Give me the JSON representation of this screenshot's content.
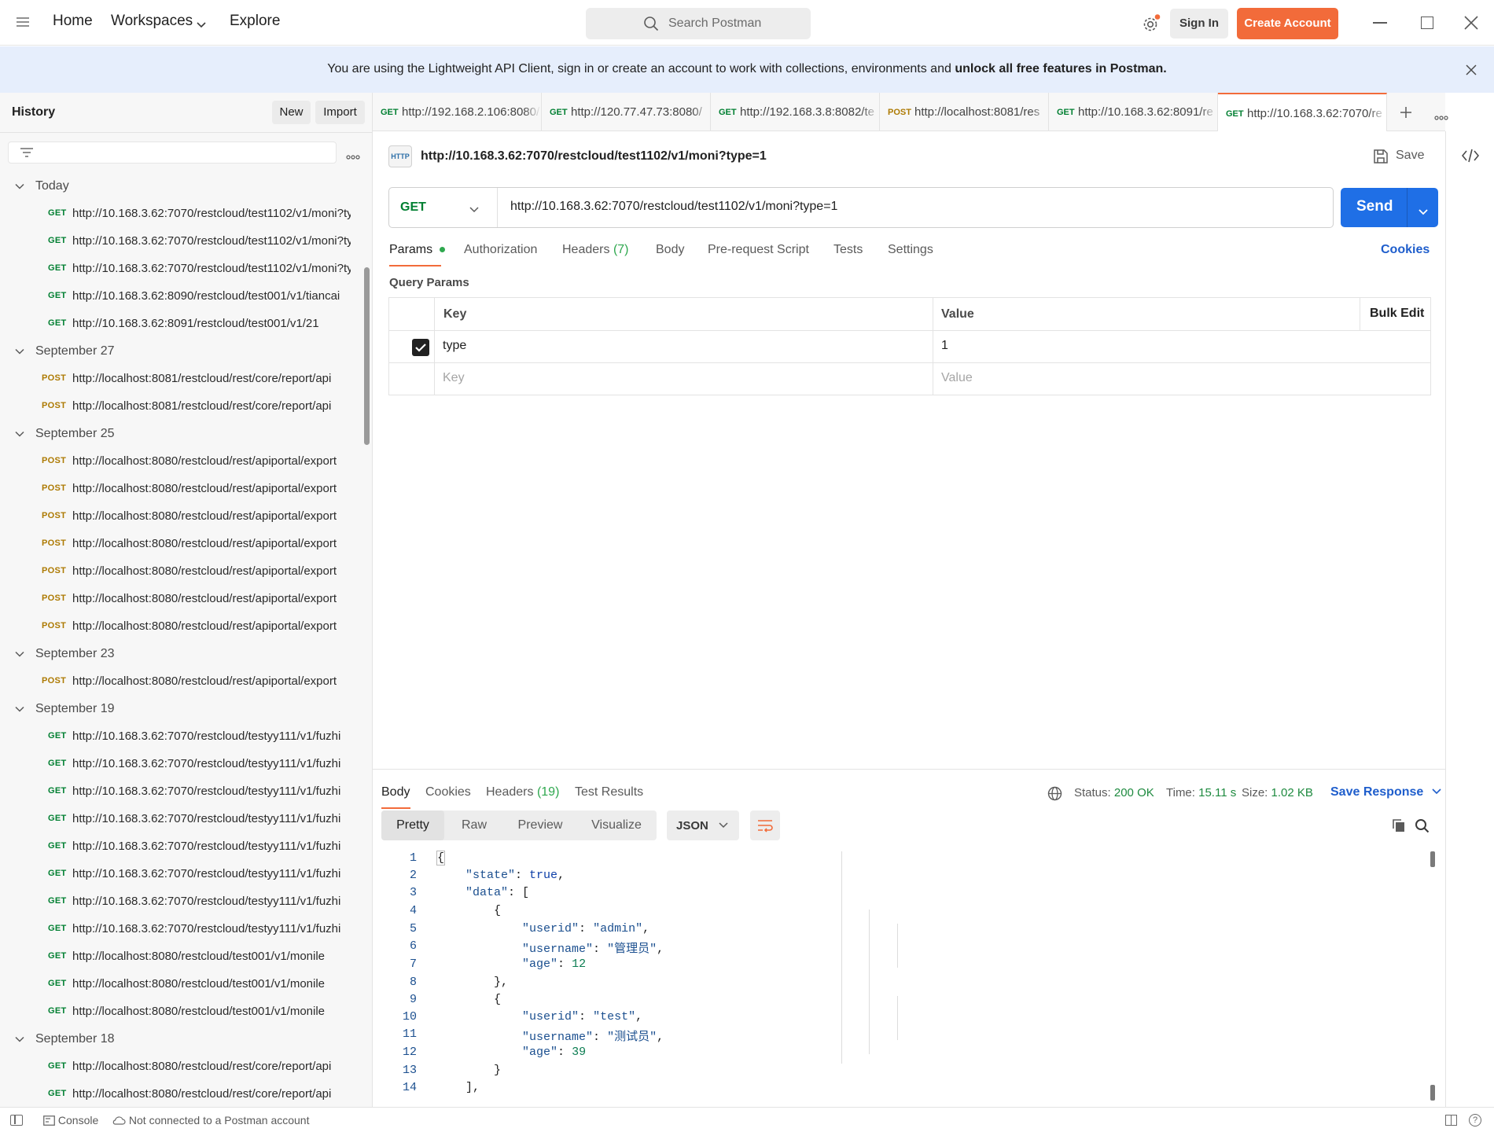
{
  "topbar": {
    "nav": {
      "home": "Home",
      "workspaces": "Workspaces",
      "explore": "Explore"
    },
    "search_label": "Search Postman",
    "sign_in": "Sign In",
    "create_account": "Create Account"
  },
  "banner": {
    "text_pre": "You are using the Lightweight API Client, sign in or create an account to work with collections, environments and ",
    "text_bold": "unlock all free features in Postman."
  },
  "sidebar": {
    "title": "History",
    "new_label": "New",
    "import_label": "Import",
    "groups": [
      {
        "label": "Today",
        "items": [
          {
            "method": "GET",
            "url": "http://10.168.3.62:7070/restcloud/test1102/v1/moni?type=1"
          },
          {
            "method": "GET",
            "url": "http://10.168.3.62:7070/restcloud/test1102/v1/moni?type=1"
          },
          {
            "method": "GET",
            "url": "http://10.168.3.62:7070/restcloud/test1102/v1/moni?type=1"
          },
          {
            "method": "GET",
            "url": "http://10.168.3.62:8090/restcloud/test001/v1/tiancai"
          },
          {
            "method": "GET",
            "url": "http://10.168.3.62:8091/restcloud/test001/v1/21"
          }
        ]
      },
      {
        "label": "September 27",
        "items": [
          {
            "method": "POST",
            "url": "http://localhost:8081/restcloud/rest/core/report/api"
          },
          {
            "method": "POST",
            "url": "http://localhost:8081/restcloud/rest/core/report/api"
          }
        ]
      },
      {
        "label": "September 25",
        "items": [
          {
            "method": "POST",
            "url": "http://localhost:8080/restcloud/rest/apiportal/export"
          },
          {
            "method": "POST",
            "url": "http://localhost:8080/restcloud/rest/apiportal/export"
          },
          {
            "method": "POST",
            "url": "http://localhost:8080/restcloud/rest/apiportal/export"
          },
          {
            "method": "POST",
            "url": "http://localhost:8080/restcloud/rest/apiportal/export"
          },
          {
            "method": "POST",
            "url": "http://localhost:8080/restcloud/rest/apiportal/export"
          },
          {
            "method": "POST",
            "url": "http://localhost:8080/restcloud/rest/apiportal/export"
          },
          {
            "method": "POST",
            "url": "http://localhost:8080/restcloud/rest/apiportal/export"
          }
        ]
      },
      {
        "label": "September 23",
        "items": [
          {
            "method": "POST",
            "url": "http://localhost:8080/restcloud/rest/apiportal/export"
          }
        ]
      },
      {
        "label": "September 19",
        "items": [
          {
            "method": "GET",
            "url": "http://10.168.3.62:7070/restcloud/testyy111/v1/fuzhi"
          },
          {
            "method": "GET",
            "url": "http://10.168.3.62:7070/restcloud/testyy111/v1/fuzhi"
          },
          {
            "method": "GET",
            "url": "http://10.168.3.62:7070/restcloud/testyy111/v1/fuzhi"
          },
          {
            "method": "GET",
            "url": "http://10.168.3.62:7070/restcloud/testyy111/v1/fuzhi"
          },
          {
            "method": "GET",
            "url": "http://10.168.3.62:7070/restcloud/testyy111/v1/fuzhi"
          },
          {
            "method": "GET",
            "url": "http://10.168.3.62:7070/restcloud/testyy111/v1/fuzhi"
          },
          {
            "method": "GET",
            "url": "http://10.168.3.62:7070/restcloud/testyy111/v1/fuzhi"
          },
          {
            "method": "GET",
            "url": "http://10.168.3.62:7070/restcloud/testyy111/v1/fuzhi"
          },
          {
            "method": "GET",
            "url": "http://localhost:8080/restcloud/test001/v1/monile"
          },
          {
            "method": "GET",
            "url": "http://localhost:8080/restcloud/test001/v1/monile"
          },
          {
            "method": "GET",
            "url": "http://localhost:8080/restcloud/test001/v1/monile"
          }
        ]
      },
      {
        "label": "September 18",
        "items": [
          {
            "method": "GET",
            "url": "http://localhost:8080/restcloud/rest/core/report/api"
          },
          {
            "method": "GET",
            "url": "http://localhost:8080/restcloud/rest/core/report/api"
          }
        ]
      }
    ]
  },
  "tabs": [
    {
      "method": "GET",
      "url": "http://192.168.2.106:8080/"
    },
    {
      "method": "GET",
      "url": "http://120.77.47.73:8080/"
    },
    {
      "method": "GET",
      "url": "http://192.168.3.8:8082/te"
    },
    {
      "method": "POST",
      "url": "http://localhost:8081/res"
    },
    {
      "method": "GET",
      "url": "http://10.168.3.62:8091/re"
    },
    {
      "method": "GET",
      "url": "http://10.168.3.62:7070/re",
      "active": true
    }
  ],
  "request": {
    "http_badge": "HTTP",
    "title": "http://10.168.3.62:7070/restcloud/test1102/v1/moni?type=1",
    "save_label": "Save",
    "method": "GET",
    "url": "http://10.168.3.62:7070/restcloud/test1102/v1/moni?type=1",
    "send_label": "Send",
    "tabs": {
      "params": "Params",
      "authorization": "Authorization",
      "headers": "Headers",
      "headers_count": "(7)",
      "body": "Body",
      "prerequest": "Pre-request Script",
      "tests": "Tests",
      "settings": "Settings"
    },
    "cookies_label": "Cookies",
    "query_params_label": "Query Params",
    "table": {
      "key_header": "Key",
      "value_header": "Value",
      "bulk_edit": "Bulk Edit",
      "rows": [
        {
          "key": "type",
          "value": "1",
          "checked": true
        }
      ],
      "key_placeholder": "Key",
      "value_placeholder": "Value"
    }
  },
  "response": {
    "tabs": {
      "body": "Body",
      "cookies": "Cookies",
      "headers": "Headers",
      "headers_count": "(19)",
      "test_results": "Test Results"
    },
    "status_label": "Status:",
    "status_value": "200 OK",
    "time_label": "Time:",
    "time_value": "15.11 s",
    "size_label": "Size:",
    "size_value": "1.02 KB",
    "save_response": "Save Response",
    "views": {
      "pretty": "Pretty",
      "raw": "Raw",
      "preview": "Preview",
      "visualize": "Visualize"
    },
    "format": "JSON",
    "code": {
      "line_numbers": [
        "1",
        "2",
        "3",
        "4",
        "5",
        "6",
        "7",
        "8",
        "9",
        "10",
        "11",
        "12",
        "13",
        "14"
      ],
      "state_key": "\"state\"",
      "state_val": "true",
      "data_key": "\"data\"",
      "items": [
        {
          "userid_key": "\"userid\"",
          "userid": "\"admin\"",
          "username_key": "\"username\"",
          "username": "\"管理员\"",
          "age_key": "\"age\"",
          "age": "12"
        },
        {
          "userid_key": "\"userid\"",
          "userid": "\"test\"",
          "username_key": "\"username\"",
          "username": "\"测试员\"",
          "age_key": "\"age\"",
          "age": "39"
        }
      ]
    }
  },
  "statusbar": {
    "console": "Console",
    "connection": "Not connected to a Postman account"
  },
  "colors": {
    "accent": "#f26b3a",
    "primary": "#1f6fe6",
    "get": "#007f31",
    "post": "#ad7a03"
  }
}
